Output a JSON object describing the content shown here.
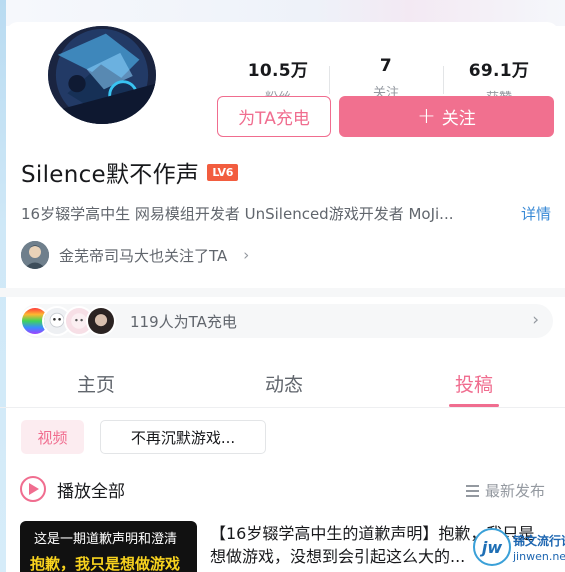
{
  "profile": {
    "stats": [
      {
        "value": "10.5万",
        "label": "粉丝"
      },
      {
        "value": "7",
        "label": "关注"
      },
      {
        "value": "69.1万",
        "label": "获赞"
      }
    ],
    "charge_button": "为TA充电",
    "follow_button": "关注",
    "follow_plus": "+",
    "name": "Silence默不作声",
    "level": "LV6",
    "bio": "16岁辍学高中生 网易模组开发者 UnSilenced游戏开发者 MoJi...",
    "detail_link": "详情",
    "mutual_text": "金芜帝司马大也关注了TA",
    "mutual_chevron": "›"
  },
  "supporters": {
    "text": "119人为TA充电",
    "chevron": "›"
  },
  "tabs": [
    {
      "label": "主页",
      "active": false
    },
    {
      "label": "动态",
      "active": false
    },
    {
      "label": "投稿",
      "active": true
    }
  ],
  "filters": {
    "video_chip": "视频",
    "series_chip": "不再沉默游戏..."
  },
  "list_controls": {
    "play_all": "播放全部",
    "sort": "最新发布"
  },
  "video": {
    "thumb_line1": "这是一期道歉声明和澄清",
    "thumb_line2": "抱歉，我只是想做游戏",
    "title": "【16岁辍学高中生的道歉声明】抱歉，我只是想做游戏，没想到会引起这么大的..."
  },
  "watermark": {
    "logo": "jw",
    "line1": "锦文流行语",
    "line2": "jinwen.net"
  },
  "colors": {
    "accent": "#f06d8f",
    "follow_bg": "#f1708f",
    "link": "#3a8ad6",
    "level_badge": "#f25d3f"
  }
}
